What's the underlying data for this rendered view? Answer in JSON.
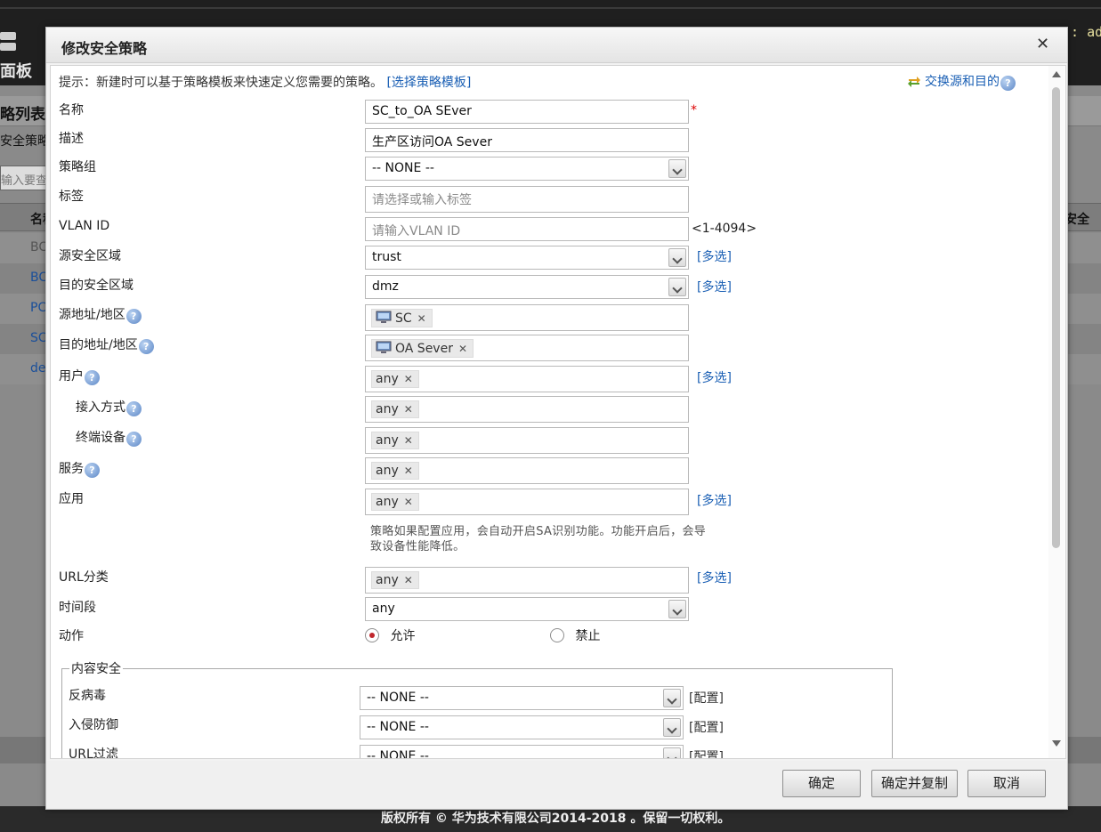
{
  "background": {
    "user_text": "ad",
    "panel_label": "面板",
    "list_title": "略列表",
    "tab_label": "安全策略",
    "search_placeholder": "输入要查",
    "grid_col_name": "名称",
    "grid_col_security": "安全",
    "rows": [
      "BC",
      "BC",
      "PC",
      "SC",
      "de"
    ],
    "footer": "版权所有 © 华为技术有限公司2014-2018 。保留一切权利。"
  },
  "dialog": {
    "title": "修改安全策略",
    "close_icon": "close-icon",
    "hint_text": "提示：新建时可以基于策略模板来快速定义您需要的策略。",
    "hint_link": "[选择策略模板]",
    "swap_label": "交换源和目的",
    "form": {
      "name_label": "名称",
      "name_value": "SC_to_OA SEver",
      "required_mark": "*",
      "desc_label": "描述",
      "desc_value": "生产区访问OA Sever",
      "group_label": "策略组",
      "group_value": "-- NONE --",
      "tag_label": "标签",
      "tag_placeholder": "请选择或输入标签",
      "vlan_label": "VLAN ID",
      "vlan_placeholder": "请输入VLAN ID",
      "vlan_range": "<1-4094>",
      "src_zone_label": "源安全区域",
      "src_zone_value": "trust",
      "dst_zone_label": "目的安全区域",
      "dst_zone_value": "dmz",
      "src_addr_label": "源地址/地区",
      "src_addr_tag": "SC",
      "dst_addr_label": "目的地址/地区",
      "dst_addr_tag": "OA Sever",
      "user_label": "用户",
      "user_tag": "any",
      "access_label": "接入方式",
      "access_tag": "any",
      "terminal_label": "终端设备",
      "terminal_tag": "any",
      "service_label": "服务",
      "service_tag": "any",
      "app_label": "应用",
      "app_tag": "any",
      "app_note": "策略如果配置应用，会自动开启SA识别功能。功能开启后，会导致设备性能降低。",
      "url_label": "URL分类",
      "url_tag": "any",
      "time_label": "时间段",
      "time_value": "any",
      "action_label": "动作",
      "action_allow": "允许",
      "action_deny": "禁止",
      "action_selected": "允许",
      "multi_select": "[多选]",
      "help_mark": "?"
    },
    "content_security": {
      "legend": "内容安全",
      "antivirus_label": "反病毒",
      "antivirus_value": "-- NONE --",
      "ips_label": "入侵防御",
      "ips_value": "-- NONE --",
      "url_filter_label": "URL过滤",
      "url_filter_value": "-- NONE --",
      "config_link": "[配置]"
    },
    "buttons": {
      "ok": "确定",
      "ok_copy": "确定并复制",
      "cancel": "取消"
    }
  }
}
